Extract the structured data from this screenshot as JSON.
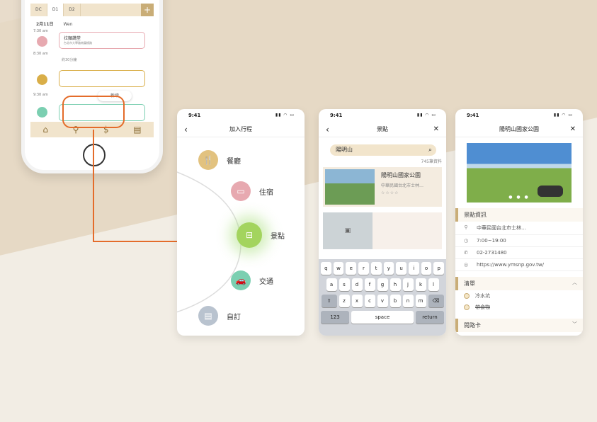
{
  "phone": {
    "tabs": [
      "DC",
      "D1",
      "D2"
    ],
    "plus": "+",
    "date": "2月11日",
    "weekday": "Wen",
    "times": [
      "7:30 am",
      "8:30 am",
      "9:30 am"
    ],
    "card1": {
      "title": "拉麵講堂",
      "sub": "台北市大學路南圍繞路"
    },
    "transit": "約30分鐘",
    "new_button": "新增",
    "tabbar": [
      "home-icon",
      "pin-icon",
      "dollar-icon",
      "money-icon"
    ]
  },
  "screen1": {
    "time": "9:41",
    "title": "加入行程",
    "back": "‹",
    "categories": [
      {
        "label": "餐廳",
        "color": "#e2c27f"
      },
      {
        "label": "住宿",
        "color": "#e7a9b0"
      },
      {
        "label": "景點",
        "color": "#a3d45e"
      },
      {
        "label": "交通",
        "color": "#7bcfb1"
      },
      {
        "label": "自訂",
        "color": "#b9c3cf"
      }
    ]
  },
  "screen2": {
    "time": "9:41",
    "title": "景點",
    "back": "‹",
    "close": "✕",
    "search_value": "陽明山",
    "count": "745筆資料",
    "result": {
      "name": "陽明山國家公園",
      "addr": "中華民國台北市士林…",
      "stars": "☆☆☆☆"
    },
    "keys_row1": [
      "q",
      "w",
      "e",
      "r",
      "t",
      "y",
      "u",
      "i",
      "o",
      "p"
    ],
    "keys_row2": [
      "a",
      "s",
      "d",
      "f",
      "g",
      "h",
      "j",
      "k",
      "l"
    ],
    "keys_row3": [
      "z",
      "x",
      "c",
      "v",
      "b",
      "n",
      "m"
    ],
    "key_num": "123",
    "key_space": "space",
    "key_return": "return"
  },
  "screen3": {
    "time": "9:41",
    "title": "陽明山國家公園",
    "back": "‹",
    "close": "✕",
    "section_info": "景點資訊",
    "address": "中華民國台北市士林…",
    "hours": "7:00~19:00",
    "phone": "02-2731480",
    "website": "https://www.ymsnp.gov.tw/",
    "section_list": "清單",
    "list_items": [
      {
        "text": "冷水坑",
        "done": false
      },
      {
        "text": "帶食物",
        "done": true
      }
    ],
    "section_card": "閱路卡",
    "dots": "● ● ●"
  }
}
